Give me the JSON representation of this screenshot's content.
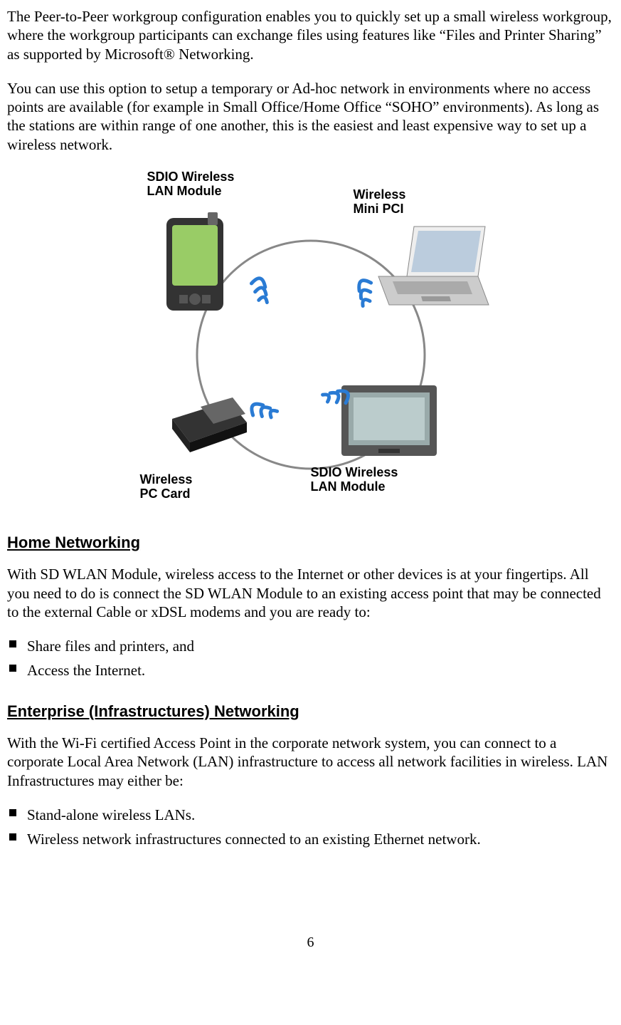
{
  "para1": "The Peer-to-Peer workgroup configuration enables you to quickly set up a small wireless workgroup, where the workgroup participants can exchange files using features like “Files and Printer Sharing” as supported by Microsoft® Networking.",
  "para2": "You can use this option to setup a temporary or Ad-hoc network in environments where no access points are available (for example in Small Office/Home Office “SOHO” environments). As long as the stations are within range of one another, this is the easiest and least expensive way to set up a wireless network.",
  "diagram": {
    "sdio_top": "SDIO Wireless\nLAN Module",
    "minipci": "Wireless\nMini PCI",
    "pccard": "Wireless\nPC Card",
    "sdio_bot": "SDIO Wireless\nLAN Module"
  },
  "heading_home": "Home Networking",
  "para_home": "With SD WLAN Module, wireless access to the Internet or other devices is at your fingertips. All you need to do is connect the SD WLAN Module to an existing access point that may be connected to the external Cable or xDSL modems and you are ready to:",
  "home_list": {
    "i1": "Share files and printers, and",
    "i2": "Access the Internet."
  },
  "heading_ent": "Enterprise (Infrastructures) Networking",
  "para_ent": "With the Wi-Fi certified Access Point in the corporate network system, you can connect to a corporate Local Area Network (LAN) infrastructure to access all network facilities in wireless. LAN Infrastructures may either be:",
  "ent_list": {
    "i1": "Stand-alone wireless LANs.",
    "i2": "Wireless network infrastructures connected to an existing Ethernet network."
  },
  "page_number": "6"
}
